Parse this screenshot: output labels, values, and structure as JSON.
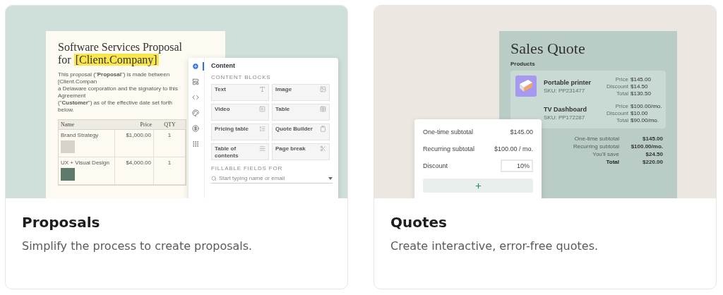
{
  "cards": [
    {
      "kind": "proposal",
      "title": "Proposals",
      "description": "Simplify the process to create proposals.",
      "document": {
        "title": "Software Services Proposal",
        "title_prefix": "for",
        "title_highlight": "[Client.Company]",
        "paragraph": [
          "This proposal (\"**Proposal**\") is made between [Client.Compan",
          "a Delaware corporation and the signatory to this Agreement",
          "(\"**Customer**\") as of the effective date set forth below."
        ],
        "columns": [
          "Name",
          "Price",
          "QTY"
        ],
        "rows": [
          {
            "name": "Brand Strategy",
            "price": "$1,000.00",
            "qty": "1"
          },
          {
            "name": "UX + Visual Design",
            "price": "$4,000.00",
            "qty": "1"
          }
        ]
      },
      "panel": {
        "rail": [
          {
            "kind": "add",
            "selected": true
          },
          {
            "kind": "layout",
            "selected": false
          },
          {
            "kind": "embed",
            "selected": false
          },
          {
            "kind": "style",
            "selected": false
          },
          {
            "kind": "pricing",
            "selected": false
          },
          {
            "kind": "apps",
            "selected": false
          }
        ],
        "heading": "Content",
        "section": "CONTENT BLOCKS",
        "blocks": [
          {
            "kind": "text",
            "label": "Text"
          },
          {
            "kind": "image",
            "label": "Image"
          },
          {
            "kind": "video",
            "label": "Video"
          },
          {
            "kind": "table",
            "label": "Table"
          },
          {
            "kind": "pricing",
            "label": "Pricing table"
          },
          {
            "kind": "quote",
            "label": "Quote Builder"
          },
          {
            "kind": "toc",
            "label": "Table of contents"
          },
          {
            "kind": "pagebreak",
            "label": "Page break"
          }
        ],
        "fields_label": "FILLABLE FIELDS FOR",
        "search": {
          "placeholder": "Start typing name or email"
        }
      }
    },
    {
      "kind": "quote",
      "title": "Quotes",
      "description": "Create interactive, error-free quotes.",
      "document": {
        "title": "Sales Quote",
        "section": "Products",
        "products": [
          {
            "name": "Portable printer",
            "sku": "SKU: PP231477",
            "lines": [
              {
                "label": "Price",
                "value": "$145.00"
              },
              {
                "label": "Discount",
                "value": "$14.50"
              },
              {
                "label": "Total",
                "value": "$130.50"
              }
            ]
          },
          {
            "name": "TV Dashboard",
            "sku": "SKU: PP172287",
            "lines": [
              {
                "label": "Price",
                "value": "$100.00/mo."
              },
              {
                "label": "Discount",
                "value": "$10.00"
              },
              {
                "label": "Total",
                "value": "$90.00/mo."
              }
            ]
          }
        ],
        "summary": [
          {
            "label": "One-time subtotal",
            "value": "$145.00"
          },
          {
            "label": "Recurring subtotal",
            "value": "$100.00/mo."
          },
          {
            "label": "You'll save",
            "value": "$24.50"
          },
          {
            "label": "Total",
            "value": "$220.00"
          }
        ]
      },
      "panel": {
        "rows": [
          {
            "label": "One-time subtotal",
            "value": "$145.00"
          },
          {
            "label": "Recurring subtotal",
            "value": "$100.00 / mo."
          }
        ],
        "discount": {
          "label": "Discount",
          "value": "10%"
        }
      }
    }
  ]
}
